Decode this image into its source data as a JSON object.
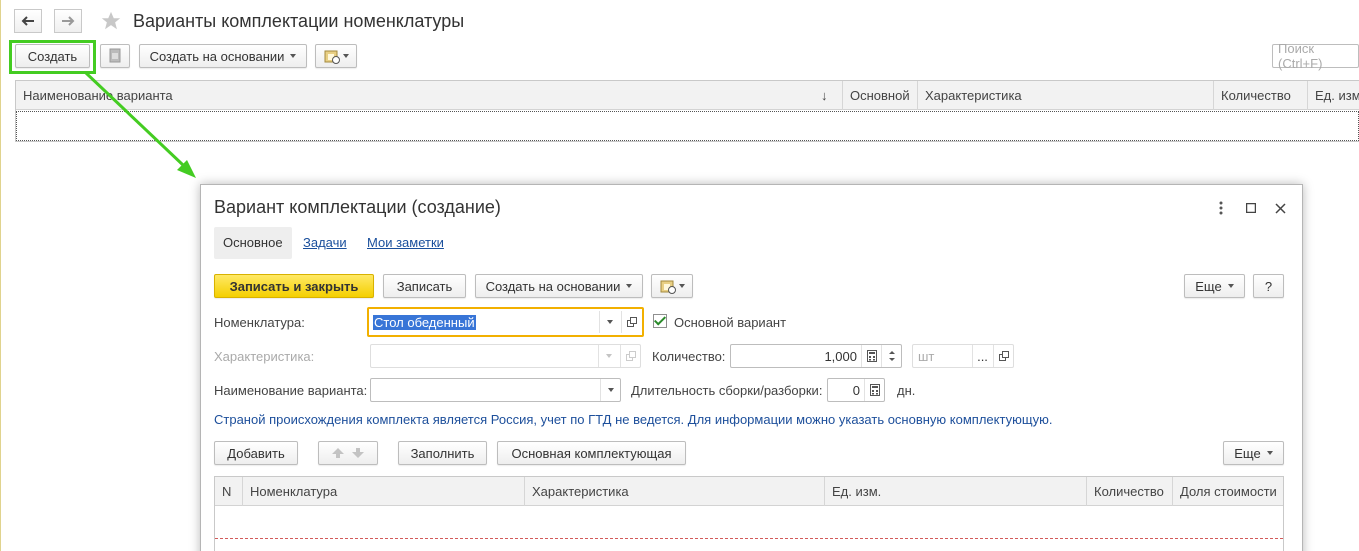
{
  "main": {
    "title": "Варианты комплектации номенклатуры",
    "toolbar": {
      "create_label": "Создать",
      "create_based_label": "Создать на основании",
      "search_placeholder": "Поиск (Ctrl+F)"
    },
    "columns": [
      "Наименование варианта",
      "↓",
      "Основной",
      "Характеристика",
      "Количество",
      "Ед. изм."
    ]
  },
  "dialog": {
    "title": "Вариант комплектации (создание)",
    "tabs": [
      "Основное",
      "Задачи",
      "Мои заметки"
    ],
    "toolbar": {
      "save_close_label": "Записать и закрыть",
      "save_label": "Записать",
      "create_based_label": "Создать на основании",
      "more_label": "Еще",
      "help_label": "?"
    },
    "form": {
      "nomenclature_label": "Номенклатура:",
      "nomenclature_value": "Стол обеденный",
      "main_variant_label": "Основной вариант",
      "main_variant_checked": true,
      "characteristic_label": "Характеристика:",
      "quantity_label": "Количество:",
      "quantity_value": "1,000",
      "unit_placeholder": "шт",
      "unit_more": "...",
      "variant_name_label": "Наименование варианта:",
      "duration_label": "Длительность сборки/разборки:",
      "duration_value": "0",
      "duration_unit": "дн."
    },
    "info_text": "Страной происхождения комплекта является Россия, учет по ГТД не ведется. Для информации можно указать основную комплектующую.",
    "table_toolbar": {
      "add_label": "Добавить",
      "fill_label": "Заполнить",
      "main_component_label": "Основная комплектующая",
      "more_label": "Еще"
    },
    "table_columns": [
      "N",
      "Номенклатура",
      "Характеристика",
      "Ед. изм.",
      "Количество",
      "Доля стоимости"
    ]
  },
  "colors": {
    "highlight": "#44cc22",
    "primary_button": "#f4cf00",
    "link": "#1a4f9c",
    "info_text": "#1d4f9b"
  }
}
